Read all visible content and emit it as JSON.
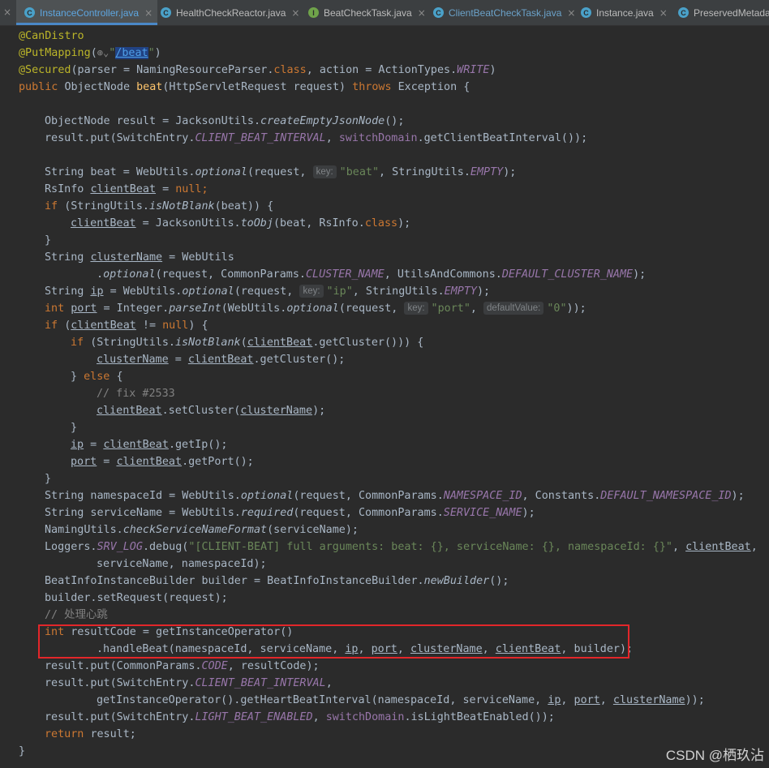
{
  "tabs": [
    {
      "label": "InstanceController.java",
      "icon": "C",
      "active": true
    },
    {
      "label": "HealthCheckReactor.java",
      "icon": "C"
    },
    {
      "label": "BeatCheckTask.java",
      "icon": "I"
    },
    {
      "label": "ClientBeatCheckTask.java",
      "icon": "C"
    },
    {
      "label": "Instance.java",
      "icon": "C"
    },
    {
      "label": "PreservedMetadat",
      "icon": "C"
    }
  ],
  "tab_close_glyph": "×",
  "watermark": "CSDN @栖玖沾",
  "code": {
    "l1": {
      "a": "@CanDistro"
    },
    "l2": {
      "a": "@PutMapping",
      "b": "(",
      "globe": "⊕⌄",
      "q1": "\"",
      "url": "/beat",
      "q2": "\"",
      "c": ")"
    },
    "l3": {
      "a": "@Secured",
      "b": "(parser = NamingResourceParser.",
      "c": "class",
      "d": ", action = ActionTypes.",
      "e": "WRITE",
      "f": ")"
    },
    "l4": {
      "a": "public ",
      "b": "ObjectNode ",
      "c": "beat",
      "d": "(HttpServletRequest request) ",
      "e": "throws ",
      "f": "Exception {"
    },
    "l5": {
      "a": "ObjectNode result = JacksonUtils.",
      "b": "createEmptyJsonNode",
      "c": "();"
    },
    "l6": {
      "a": "result.put(SwitchEntry.",
      "b": "CLIENT_BEAT_INTERVAL",
      "c": ", ",
      "d": "switchDomain",
      "e": ".getClientBeatInterval());"
    },
    "l7": {
      "a": "String beat = WebUtils.",
      "b": "optional",
      "c": "(request, ",
      "hint": "key:",
      "d": "\"beat\"",
      "e": ", StringUtils.",
      "f": "EMPTY",
      "g": ");"
    },
    "l8": {
      "a": "RsInfo ",
      "b": "clientBeat",
      "c": " = ",
      "d": "null",
      "e": ";"
    },
    "l9": {
      "a": "if ",
      "b": "(StringUtils.",
      "c": "isNotBlank",
      "d": "(beat)) {"
    },
    "l10": {
      "a": "clientBeat",
      "b": " = JacksonUtils.",
      "c": "toObj",
      "d": "(beat, RsInfo.",
      "e": "class",
      "f": ");"
    },
    "l11": {
      "a": "}"
    },
    "l12": {
      "a": "String ",
      "b": "clusterName",
      "c": " = WebUtils"
    },
    "l13": {
      "a": ".",
      "b": "optional",
      "c": "(request, CommonParams.",
      "d": "CLUSTER_NAME",
      "e": ", UtilsAndCommons.",
      "f": "DEFAULT_CLUSTER_NAME",
      "g": ");"
    },
    "l14": {
      "a": "String ",
      "b": "ip",
      "c": " = WebUtils.",
      "d": "optional",
      "e": "(request, ",
      "hint": "key:",
      "f": "\"ip\"",
      "g": ", StringUtils.",
      "h": "EMPTY",
      "i": ");"
    },
    "l15": {
      "a": "int ",
      "b": "port",
      "c": " = Integer.",
      "d": "parseInt",
      "e": "(WebUtils.",
      "f": "optional",
      "g": "(request, ",
      "hint1": "key:",
      "h": "\"port\"",
      "i": ", ",
      "hint2": "defaultValue:",
      "j": "\"0\"",
      "k": "));"
    },
    "l16": {
      "a": "if ",
      "b": "(",
      "c": "clientBeat",
      "d": " != ",
      "e": "null",
      "f": ") {"
    },
    "l17": {
      "a": "if ",
      "b": "(StringUtils.",
      "c": "isNotBlank",
      "d": "(",
      "e": "clientBeat",
      "f": ".getCluster())) {"
    },
    "l18": {
      "a": "clusterName",
      "b": " = ",
      "c": "clientBeat",
      "d": ".getCluster();"
    },
    "l19": {
      "a": "} ",
      "b": "else ",
      "c": "{"
    },
    "l20": {
      "a": "// fix #2533"
    },
    "l21": {
      "a": "clientBeat",
      "b": ".setCluster(",
      "c": "clusterName",
      "d": ");"
    },
    "l22": {
      "a": "}"
    },
    "l23": {
      "a": "ip",
      "b": " = ",
      "c": "clientBeat",
      "d": ".getIp();"
    },
    "l24": {
      "a": "port",
      "b": " = ",
      "c": "clientBeat",
      "d": ".getPort();"
    },
    "l25": {
      "a": "}"
    },
    "l26": {
      "a": "String namespaceId = WebUtils.",
      "b": "optional",
      "c": "(request, CommonParams.",
      "d": "NAMESPACE_ID",
      "e": ", Constants.",
      "f": "DEFAULT_NAMESPACE_ID",
      "g": ");"
    },
    "l27": {
      "a": "String serviceName = WebUtils.",
      "b": "required",
      "c": "(request, CommonParams.",
      "d": "SERVICE_NAME",
      "e": ");"
    },
    "l28": {
      "a": "NamingUtils.",
      "b": "checkServiceNameFormat",
      "c": "(serviceName);"
    },
    "l29": {
      "a": "Loggers.",
      "b": "SRV_LOG",
      "c": ".debug(",
      "d": "\"[CLIENT-BEAT] full arguments: beat: {}, serviceName: {}, namespaceId: {}\"",
      "e": ", ",
      "f": "clientBeat",
      "g": ","
    },
    "l30": {
      "a": "serviceName, namespaceId);"
    },
    "l31": {
      "a": "BeatInfoInstanceBuilder builder = BeatInfoInstanceBuilder.",
      "b": "newBuilder",
      "c": "();"
    },
    "l32": {
      "a": "builder.setRequest(request);"
    },
    "l33": {
      "a": "// 处理心跳"
    },
    "l34": {
      "a": "int ",
      "b": "resultCode = getInstanceOperator()"
    },
    "l35": {
      "a": ".handleBeat(namespaceId, serviceName, ",
      "b": "ip",
      "c": ", ",
      "d": "port",
      "e": ", ",
      "f": "clusterName",
      "g": ", ",
      "h": "clientBeat",
      "i": ", builder);"
    },
    "l36": {
      "a": "result.put(CommonParams.",
      "b": "CODE",
      "c": ", resultCode);"
    },
    "l37": {
      "a": "result.put(SwitchEntry.",
      "b": "CLIENT_BEAT_INTERVAL",
      "c": ","
    },
    "l38": {
      "a": "getInstanceOperator().getHeartBeatInterval(namespaceId, serviceName, ",
      "b": "ip",
      "c": ", ",
      "d": "port",
      "e": ", ",
      "f": "clusterName",
      "g": "));"
    },
    "l39": {
      "a": "result.put(SwitchEntry.",
      "b": "LIGHT_BEAT_ENABLED",
      "c": ", ",
      "d": "switchDomain",
      "e": ".isLightBeatEnabled());"
    },
    "l40": {
      "a": "return ",
      "b": "result;"
    },
    "l41": {
      "a": "}"
    }
  }
}
